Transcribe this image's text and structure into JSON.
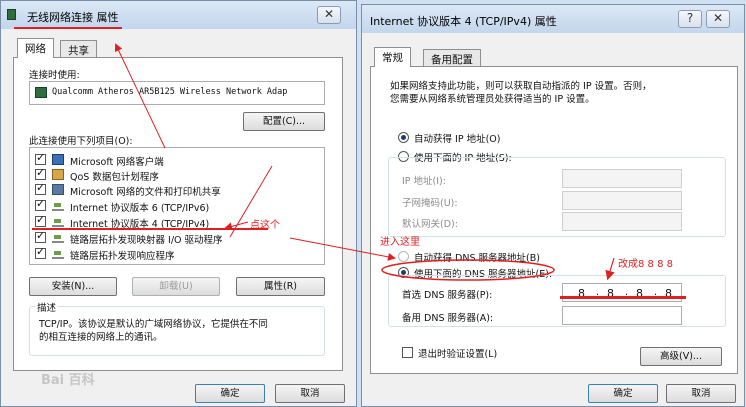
{
  "left_dialog": {
    "title": "无线网络连接 属性",
    "tabs": [
      "网络",
      "共享"
    ],
    "connect_using_label": "连接时使用:",
    "adapter_name": "Qualcomm Atheros AR5B125 Wireless Network Adap",
    "configure_button": "配置(C)...",
    "items_label": "此连接使用下列项目(O):",
    "items": [
      {
        "label": "Microsoft 网络客户端",
        "checked": true,
        "icon": "network-client-icon"
      },
      {
        "label": "QoS 数据包计划程序",
        "checked": true,
        "icon": "qos-scheduler-icon"
      },
      {
        "label": "Microsoft 网络的文件和打印机共享",
        "checked": true,
        "icon": "file-printer-share-icon"
      },
      {
        "label": "Internet 协议版本 6 (TCP/IPv6)",
        "checked": true,
        "icon": "protocol-icon"
      },
      {
        "label": "Internet 协议版本 4 (TCP/IPv4)",
        "checked": true,
        "icon": "protocol-icon"
      },
      {
        "label": "链路层拓扑发现映射器 I/O 驱动程序",
        "checked": true,
        "icon": "protocol-icon"
      },
      {
        "label": "链路层拓扑发现响应程序",
        "checked": true,
        "icon": "protocol-icon"
      }
    ],
    "install_button": "安装(N)...",
    "uninstall_button": "卸载(U)",
    "properties_button": "属性(R)",
    "description_label": "描述",
    "description_text_line1": "TCP/IP。该协议是默认的广域网络协议，它提供在不同",
    "description_text_line2": "的相互连接的网络上的通讯。",
    "ok_button": "确定",
    "cancel_button": "取消"
  },
  "right_dialog": {
    "title": "Internet 协议版本 4 (TCP/IPv4) 属性",
    "tabs": [
      "常规",
      "备用配置"
    ],
    "info_line1": "如果网络支持此功能，则可以获取自动指派的 IP 设置。否则，",
    "info_line2": "您需要从网络系统管理员处获得适当的 IP 设置。",
    "auto_ip_label": "自动获得 IP 地址(O)",
    "manual_ip_label": "使用下面的 IP 地址(S):",
    "ip_address_label": "IP 地址(I):",
    "subnet_label": "子网掩码(U):",
    "gateway_label": "默认网关(D):",
    "auto_dns_label": "自动获得 DNS 服务器地址(B)",
    "manual_dns_label": "使用下面的 DNS 服务器地址(E):",
    "preferred_dns_label": "首选 DNS 服务器(P):",
    "preferred_dns_value": [
      "8",
      "8",
      "8",
      "8"
    ],
    "alternate_dns_label": "备用 DNS 服务器(A):",
    "validate_label": "退出时验证设置(L)",
    "advanced_button": "高级(V)...",
    "ok_button": "确定",
    "cancel_button": "取消",
    "selected": {
      "ip_mode": "auto",
      "dns_mode": "manual",
      "validate_on_exit": false
    }
  },
  "annotations": {
    "click_here": "点这个",
    "enter_here": "进入这里",
    "change_to": "改成8 8 8 8",
    "color": "#e02020"
  },
  "watermark": "Bai 百科"
}
